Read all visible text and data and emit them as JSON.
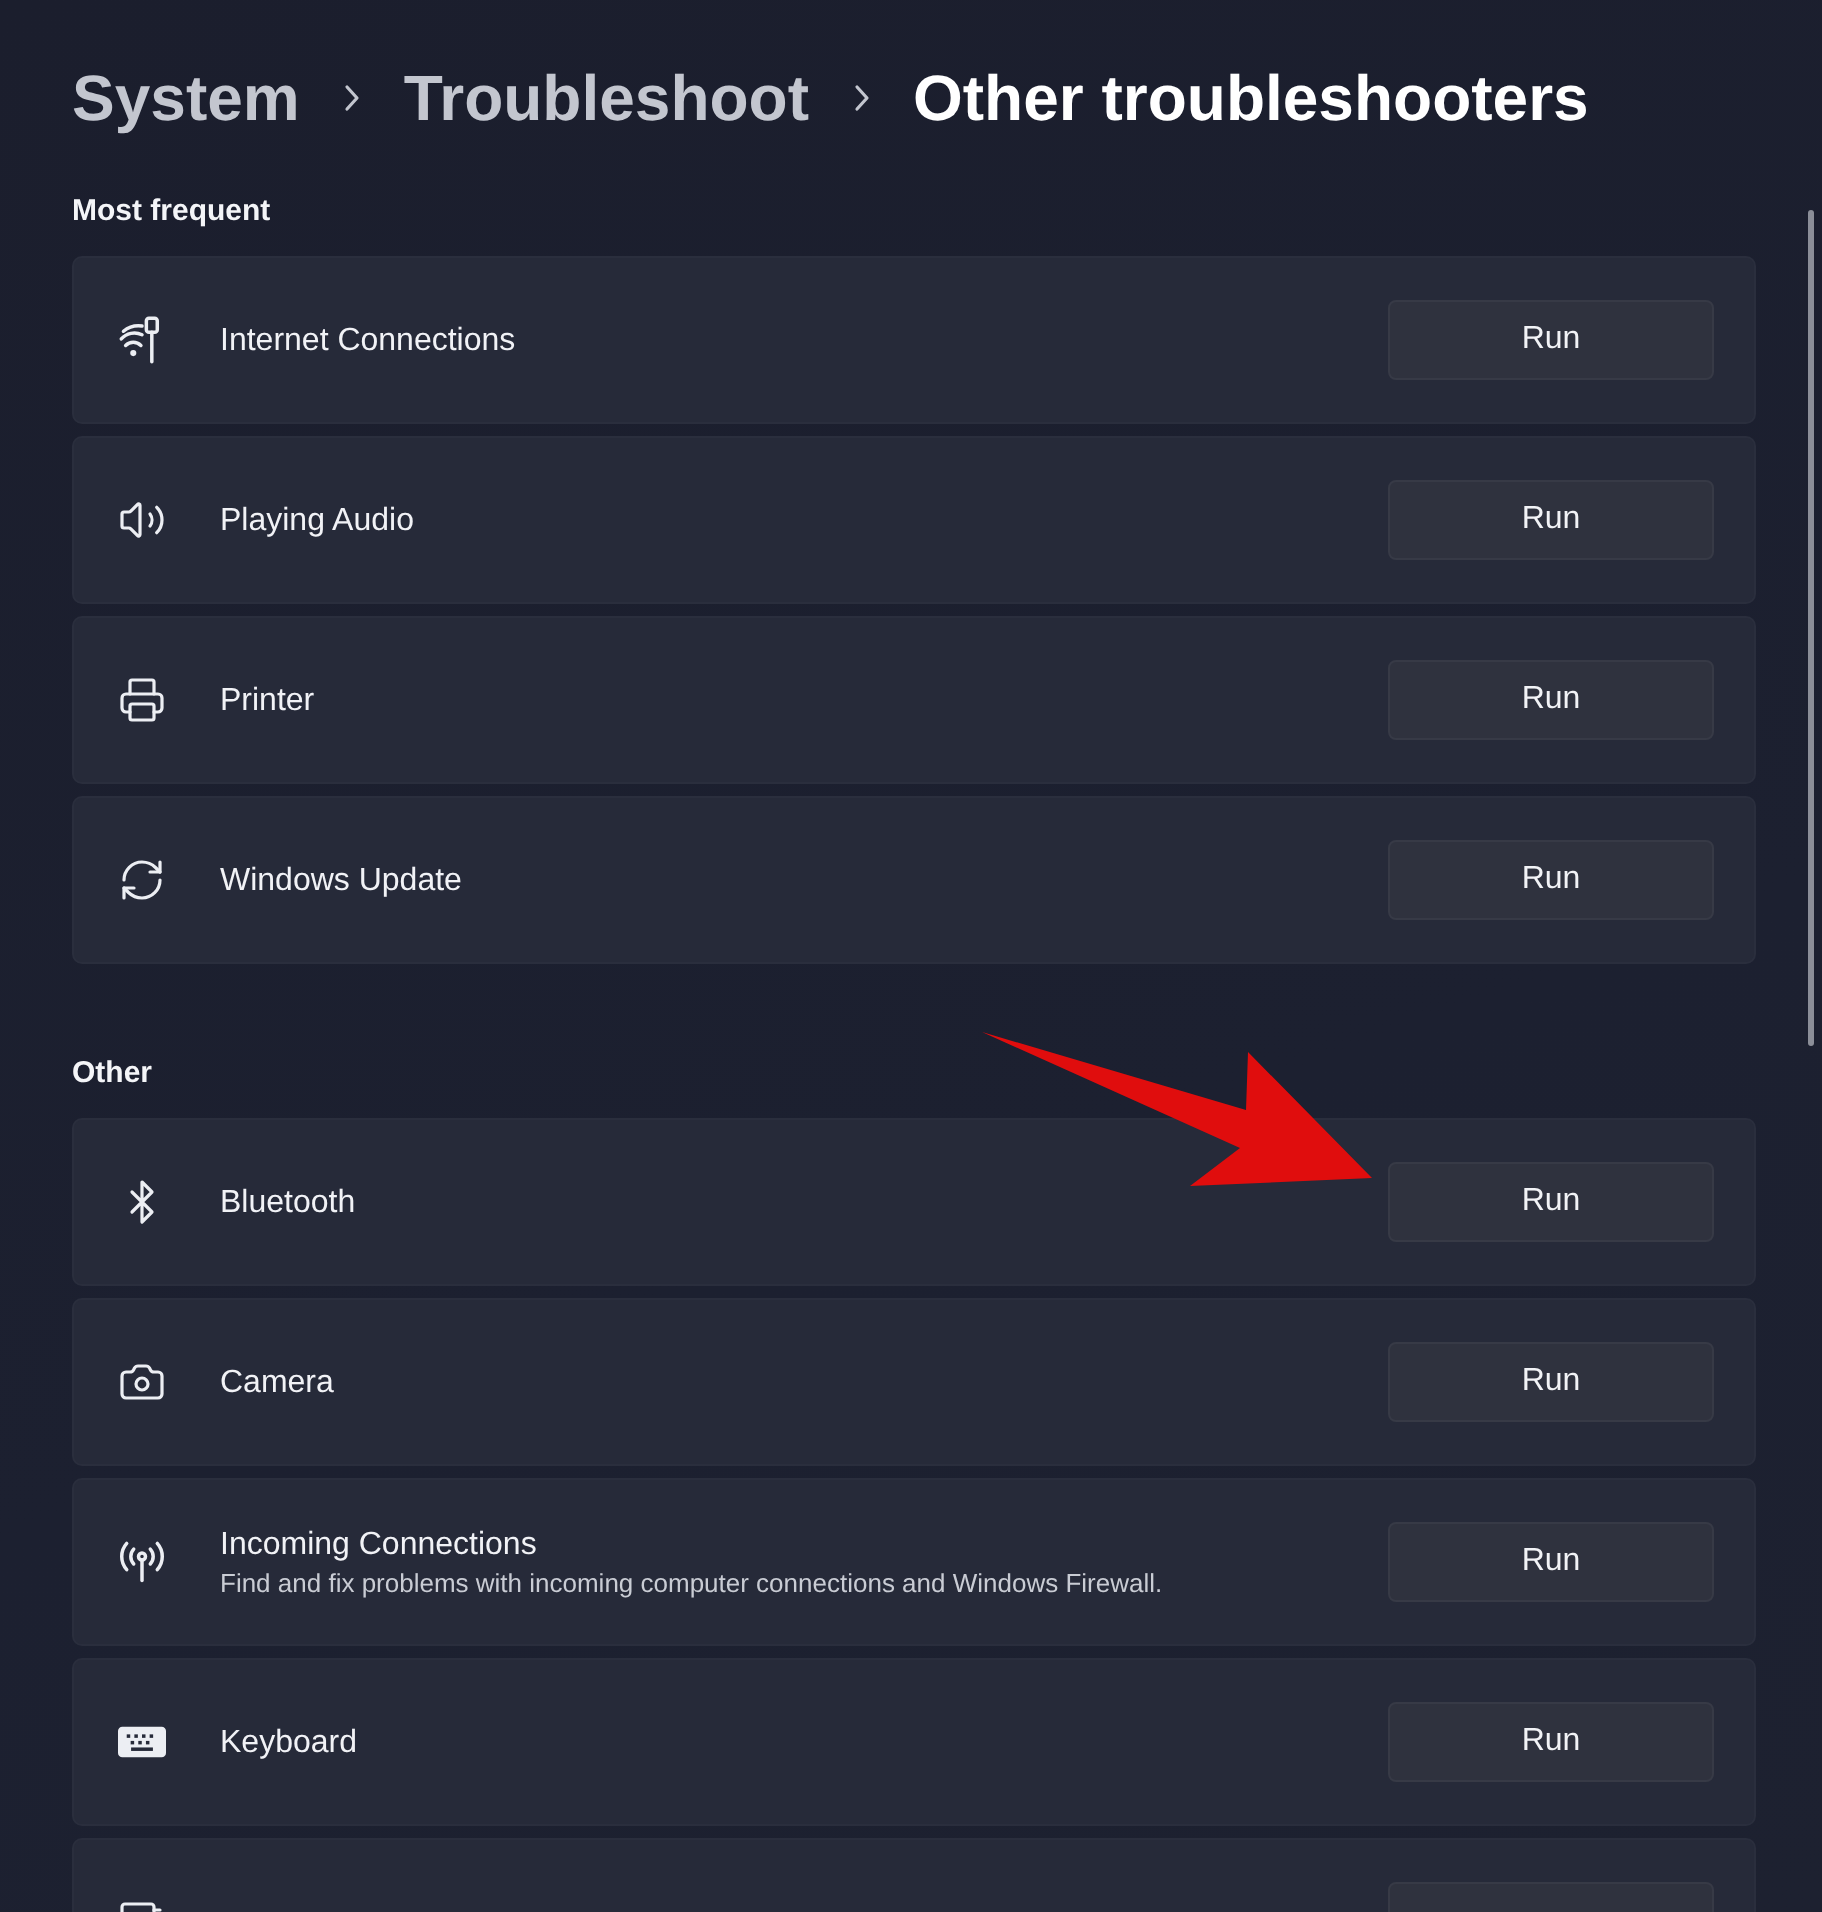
{
  "breadcrumb": [
    {
      "label": "System",
      "current": false
    },
    {
      "label": "Troubleshoot",
      "current": false
    },
    {
      "label": "Other troubleshooters",
      "current": true
    }
  ],
  "sections": [
    {
      "heading": "Most frequent",
      "items": [
        {
          "kind": "row",
          "title": "Internet Connections",
          "button": "Run"
        },
        {
          "kind": "row",
          "title": "Playing Audio",
          "button": "Run"
        },
        {
          "kind": "row",
          "title": "Printer",
          "button": "Run"
        },
        {
          "kind": "row",
          "title": "Windows Update",
          "button": "Run"
        }
      ]
    },
    {
      "heading": "Other",
      "items": [
        {
          "kind": "row",
          "title": "Bluetooth",
          "button": "Run"
        },
        {
          "kind": "row",
          "title": "Camera",
          "button": "Run"
        },
        {
          "kind": "row",
          "title": "Incoming Connections",
          "description": "Find and fix problems with incoming computer connections and Windows Firewall.",
          "button": "Run"
        },
        {
          "kind": "row",
          "title": "Keyboard",
          "button": "Run"
        },
        {
          "kind": "cut_off"
        }
      ]
    }
  ],
  "annotations": [
    {
      "kind": "arrow"
    }
  ]
}
